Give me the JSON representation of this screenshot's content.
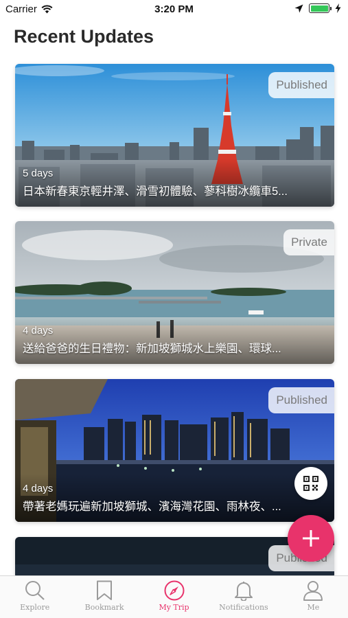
{
  "status_bar": {
    "carrier": "Carrier",
    "time": "3:20 PM",
    "battery_level": 1.0
  },
  "page": {
    "title": "Recent Updates"
  },
  "cards": [
    {
      "badge": "Published",
      "duration": "5 days",
      "title": "日本新春東京輕井澤、滑雪初體驗、蓼科樹冰纜車5...",
      "scene": "tokyo-tower-city"
    },
    {
      "badge": "Private",
      "duration": "4 days",
      "title": "送給爸爸的生日禮物：新加坡獅城水上樂園、環球...",
      "scene": "beach-pier"
    },
    {
      "badge": "Published",
      "duration": "4 days",
      "title": "帶著老媽玩遍新加坡獅城、濱海灣花園、雨林夜、...",
      "scene": "singapore-night-skyline"
    },
    {
      "badge": "Published",
      "scene": "dark-partial"
    }
  ],
  "colors": {
    "accent": "#e8336b",
    "tab_inactive": "#9a9a9a",
    "badge_text": "#7a7a7a"
  },
  "tabs": [
    {
      "label": "Explore",
      "icon": "search-icon"
    },
    {
      "label": "Bookmark",
      "icon": "bookmark-icon"
    },
    {
      "label": "My Trip",
      "icon": "compass-icon",
      "active": true
    },
    {
      "label": "Notifications",
      "icon": "bell-icon"
    },
    {
      "label": "Me",
      "icon": "person-icon"
    }
  ]
}
